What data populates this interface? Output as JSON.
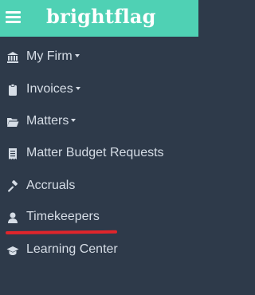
{
  "header": {
    "brand": "brightflag",
    "menu_icon": "hamburger-menu-icon",
    "background_color": "#4fd1b4"
  },
  "sidebar": {
    "background_color": "#2e3a4a",
    "items": [
      {
        "label": "My Firm",
        "icon": "bank-icon",
        "has_dropdown": true
      },
      {
        "label": "Invoices",
        "icon": "clipboard-icon",
        "has_dropdown": true
      },
      {
        "label": "Matters",
        "icon": "folder-open-icon",
        "has_dropdown": true
      },
      {
        "label": "Matter Budget Requests",
        "icon": "receipt-icon",
        "has_dropdown": false
      },
      {
        "label": "Accruals",
        "icon": "gavel-icon",
        "has_dropdown": false
      },
      {
        "label": "Timekeepers",
        "icon": "user-icon",
        "has_dropdown": false
      },
      {
        "label": "Learning Center",
        "icon": "graduation-cap-icon",
        "has_dropdown": false
      }
    ]
  },
  "annotation": {
    "underlined_item": "Timekeepers",
    "color": "#e0252b"
  }
}
